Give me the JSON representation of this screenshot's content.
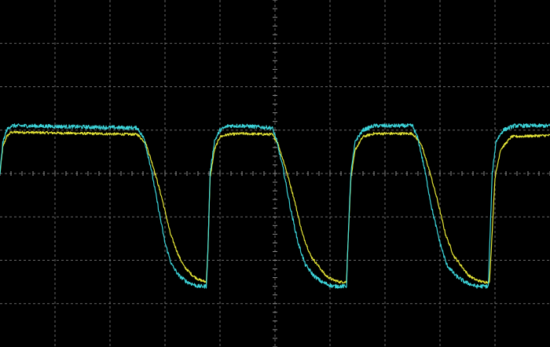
{
  "colors": {
    "background": "#000000",
    "grid": "#8a8a8a",
    "channel1": "#f2f23a",
    "channel2": "#3fe0e6"
  },
  "chart_data": {
    "type": "line",
    "title": "",
    "xlabel": "",
    "ylabel": "",
    "grid": true,
    "divisions": {
      "x": 10,
      "y": 8
    },
    "xlim": [
      0,
      10
    ],
    "ylim": [
      -4,
      4
    ],
    "series": [
      {
        "color_key": "channel1",
        "x": [
          0.0,
          0.05,
          0.12,
          0.2,
          0.4,
          2.5,
          2.65,
          2.8,
          2.95,
          3.1,
          3.25,
          3.35,
          3.5,
          3.62,
          3.75,
          3.78,
          3.82,
          3.9,
          4.0,
          4.15,
          4.4,
          4.95,
          5.05,
          5.2,
          5.35,
          5.5,
          5.65,
          5.8,
          5.92,
          6.05,
          6.18,
          6.3,
          6.32,
          6.38,
          6.46,
          6.6,
          6.8,
          7.5,
          7.65,
          7.8,
          7.95,
          8.1,
          8.25,
          8.4,
          8.52,
          8.65,
          8.78,
          8.9,
          8.93,
          9.0,
          9.1,
          9.3,
          10.0
        ],
        "y": [
          0.0,
          0.6,
          0.85,
          0.95,
          0.95,
          0.9,
          0.7,
          0.1,
          -0.6,
          -1.4,
          -1.9,
          -2.15,
          -2.35,
          -2.45,
          -2.5,
          -1.8,
          -0.1,
          0.55,
          0.85,
          0.9,
          0.92,
          0.9,
          0.7,
          0.1,
          -0.6,
          -1.4,
          -1.9,
          -2.15,
          -2.35,
          -2.45,
          -2.5,
          -2.5,
          -1.8,
          -0.1,
          0.55,
          0.85,
          0.92,
          0.92,
          0.7,
          0.1,
          -0.6,
          -1.4,
          -1.9,
          -2.15,
          -2.35,
          -2.45,
          -2.5,
          -2.5,
          -1.8,
          -0.1,
          0.55,
          0.85,
          0.88
        ]
      },
      {
        "color_key": "channel2",
        "x": [
          0.0,
          0.05,
          0.12,
          0.2,
          0.4,
          2.5,
          2.62,
          2.75,
          2.88,
          3.0,
          3.12,
          3.25,
          3.4,
          3.6,
          3.75,
          3.78,
          3.82,
          3.9,
          4.0,
          4.15,
          4.4,
          4.95,
          5.02,
          5.15,
          5.28,
          5.42,
          5.55,
          5.7,
          5.85,
          6.05,
          6.3,
          6.32,
          6.38,
          6.46,
          6.6,
          6.8,
          7.5,
          7.6,
          7.72,
          7.85,
          8.0,
          8.12,
          8.28,
          8.45,
          8.65,
          8.88,
          8.9,
          8.95,
          9.02,
          9.15,
          9.35,
          10.0
        ],
        "y": [
          0.0,
          0.7,
          1.0,
          1.1,
          1.1,
          1.05,
          0.8,
          0.1,
          -0.8,
          -1.6,
          -2.1,
          -2.35,
          -2.5,
          -2.6,
          -2.6,
          -1.8,
          0.0,
          0.75,
          1.0,
          1.1,
          1.1,
          1.05,
          0.8,
          0.1,
          -0.8,
          -1.6,
          -2.1,
          -2.35,
          -2.5,
          -2.6,
          -2.6,
          -1.8,
          0.0,
          0.75,
          1.0,
          1.1,
          1.1,
          0.8,
          0.1,
          -0.8,
          -1.6,
          -2.1,
          -2.35,
          -2.5,
          -2.6,
          -2.6,
          -1.8,
          0.0,
          0.75,
          1.0,
          1.1,
          1.1
        ]
      }
    ]
  }
}
